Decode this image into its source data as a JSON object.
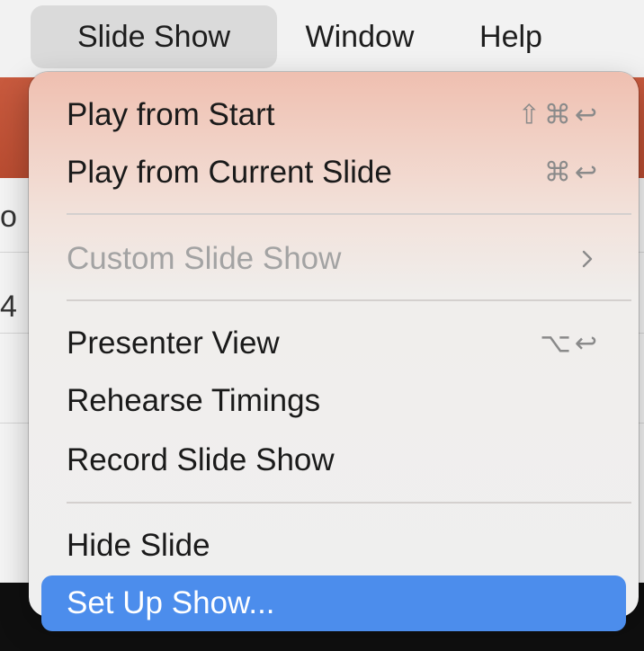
{
  "menubar": {
    "items": [
      {
        "label": "Slide Show",
        "active": true
      },
      {
        "label": "Window",
        "active": false
      },
      {
        "label": "Help",
        "active": false
      }
    ]
  },
  "background": {
    "fragment_1": "o",
    "fragment_2": "4"
  },
  "menu": {
    "items": [
      {
        "label": "Play from Start",
        "shortcut": "⇧⌘↩",
        "enabled": true
      },
      {
        "label": "Play from Current Slide",
        "shortcut": "⌘↩",
        "enabled": true
      },
      {
        "label": "Custom Slide Show",
        "submenu_icon": "chevron-right-icon",
        "enabled": false
      },
      {
        "label": "Presenter View",
        "shortcut": "⌥↩",
        "enabled": true
      },
      {
        "label": "Rehearse Timings",
        "enabled": true
      },
      {
        "label": "Record Slide Show",
        "enabled": true
      },
      {
        "label": "Hide Slide",
        "enabled": true
      },
      {
        "label": "Set Up Show...",
        "enabled": true,
        "highlighted": true
      }
    ]
  },
  "colors": {
    "highlight": "#4c8dec",
    "ribbon": "#c85a3e",
    "disabled_text": "#a3a3a3"
  }
}
